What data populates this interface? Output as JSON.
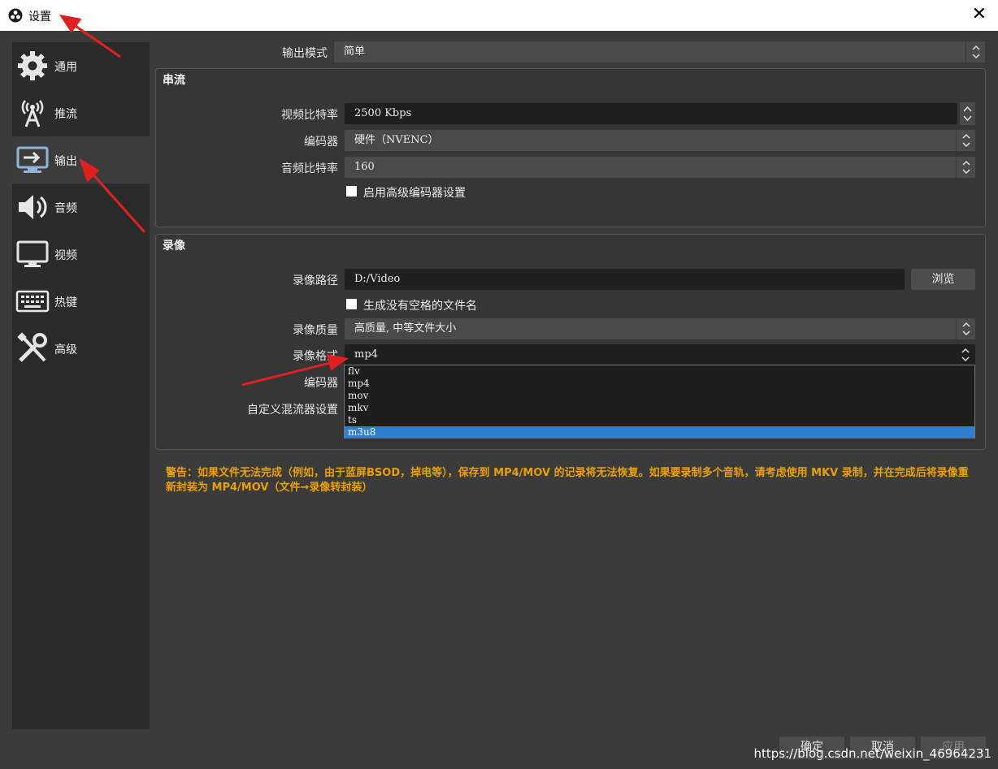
{
  "window": {
    "title": "设置",
    "close_glyph": "✕"
  },
  "sidebar": {
    "items": [
      {
        "label": "通用",
        "icon": "gear-icon"
      },
      {
        "label": "推流",
        "icon": "broadcast-icon"
      },
      {
        "label": "输出",
        "icon": "output-icon",
        "active": true
      },
      {
        "label": "音频",
        "icon": "speaker-icon"
      },
      {
        "label": "视频",
        "icon": "monitor-icon"
      },
      {
        "label": "热键",
        "icon": "keyboard-icon"
      },
      {
        "label": "高级",
        "icon": "tools-icon"
      }
    ]
  },
  "output_mode": {
    "label": "输出模式",
    "value": "简单"
  },
  "streaming": {
    "title": "串流",
    "video_bitrate": {
      "label": "视频比特率",
      "value": "2500 Kbps"
    },
    "encoder": {
      "label": "编码器",
      "value": "硬件（NVENC）"
    },
    "audio_bitrate": {
      "label": "音频比特率",
      "value": "160"
    },
    "advanced_checkbox": {
      "label": "启用高级编码器设置",
      "checked": false
    }
  },
  "recording": {
    "title": "录像",
    "path": {
      "label": "录像路径",
      "value": "D:/Video",
      "browse": "浏览"
    },
    "no_space_checkbox": {
      "label": "生成没有空格的文件名",
      "checked": false
    },
    "quality": {
      "label": "录像质量",
      "value": "高质量, 中等文件大小"
    },
    "format": {
      "label": "录像格式",
      "value": "mp4",
      "options": [
        "flv",
        "mp4",
        "mov",
        "mkv",
        "ts",
        "m3u8"
      ],
      "highlighted": "m3u8"
    },
    "encoder": {
      "label": "编码器"
    },
    "muxer": {
      "label": "自定义混流器设置"
    }
  },
  "warning": "警告：如果文件无法完成（例如，由于蓝屏BSOD，掉电等），保存到 MP4/MOV 的记录将无法恢复。如果要录制多个音轨，请考虑使用 MKV 录制，并在完成后将录像重新封装为 MP4/MOV（文件→录像转封装）",
  "footer": {
    "ok": "确定",
    "cancel": "取消",
    "apply": "应用"
  },
  "watermark": "https://blog.csdn.net/weixin_46964231",
  "colors": {
    "warning": "#e8a000",
    "selection": "#2f7fd1",
    "arrow": "#e02020"
  }
}
